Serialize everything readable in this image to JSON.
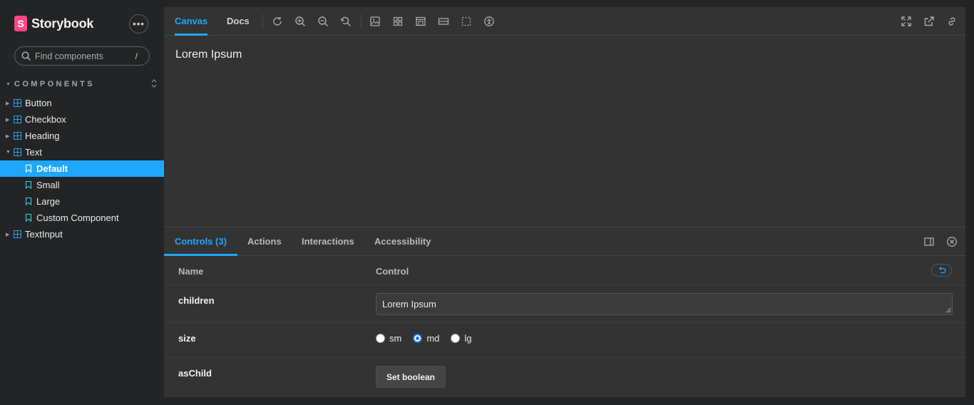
{
  "brand": {
    "name": "Storybook",
    "logo_letter": "S",
    "color": "#ff4785"
  },
  "sidebar": {
    "menu_label": "•••",
    "search": {
      "placeholder": "Find components",
      "shortcut": "/"
    },
    "section_title": "COMPONENTS",
    "tree": [
      {
        "label": "Button",
        "type": "component",
        "expanded": false
      },
      {
        "label": "Checkbox",
        "type": "component",
        "expanded": false
      },
      {
        "label": "Heading",
        "type": "component",
        "expanded": false
      },
      {
        "label": "Text",
        "type": "component",
        "expanded": true
      },
      {
        "label": "Default",
        "type": "story",
        "selected": true
      },
      {
        "label": "Small",
        "type": "story"
      },
      {
        "label": "Large",
        "type": "story"
      },
      {
        "label": "Custom Component",
        "type": "story"
      },
      {
        "label": "TextInput",
        "type": "component",
        "expanded": false
      }
    ]
  },
  "toolbar": {
    "tabs": [
      "Canvas",
      "Docs"
    ],
    "active_tab": "Canvas",
    "icons": [
      "reload-icon",
      "zoom-in-icon",
      "zoom-out-icon",
      "zoom-reset-icon",
      "background-icon",
      "grid-icon",
      "viewport-icon",
      "measure-icon",
      "outline-icon",
      "accessibility-icon",
      "fullscreen-icon",
      "open-new-tab-icon",
      "copy-link-icon"
    ]
  },
  "canvas": {
    "text": "Lorem Ipsum"
  },
  "panel": {
    "tabs": [
      "Controls (3)",
      "Actions",
      "Interactions",
      "Accessibility"
    ],
    "active_tab": "Controls (3)",
    "headers": {
      "name": "Name",
      "control": "Control"
    },
    "rows": {
      "children": {
        "name": "children",
        "value": "Lorem Ipsum"
      },
      "size": {
        "name": "size",
        "options": [
          "sm",
          "md",
          "lg"
        ],
        "selected": "md"
      },
      "asChild": {
        "name": "asChild",
        "button": "Set boolean"
      }
    }
  },
  "colors": {
    "accent": "#1ea7fd",
    "sidebar_bg": "#222425",
    "main_bg": "#333333"
  }
}
